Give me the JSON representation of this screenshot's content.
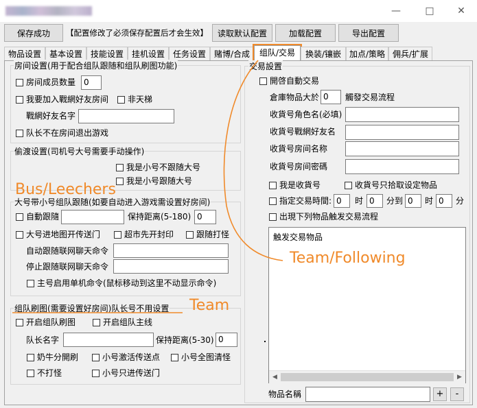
{
  "window": {
    "minimize": "—",
    "maximize": "□",
    "close": "✕"
  },
  "toolbar": {
    "save_label": "保存成功",
    "notice": "【配置修改了必须保存配置后才会生效】",
    "read_default_label": "读取默认配置",
    "load_label": "加载配置",
    "export_label": "导出配置"
  },
  "tabs": [
    {
      "label": "物品设置"
    },
    {
      "label": "基本设置"
    },
    {
      "label": "技能设置"
    },
    {
      "label": "挂机设置"
    },
    {
      "label": "任务设置"
    },
    {
      "label": "赌博/合成"
    },
    {
      "label": "组队/交易"
    },
    {
      "label": "换装/镶嵌"
    },
    {
      "label": "加点/策略"
    },
    {
      "label": "佣兵/扩展"
    }
  ],
  "room": {
    "title": "房间设置(用于配合组队跟随和组队刷图功能)",
    "member_count_label": "房间成员数量",
    "member_count_value": "0",
    "join_friend_label": "我要加入戰網好友房间",
    "non_ladder_label": "非天梯",
    "friend_name_label": "戰網好友名字",
    "friend_name_value": "",
    "leader_exit_label": "队长不在房间退出游戏"
  },
  "ferry": {
    "title": "偷渡设置(司机号大号需要手动操作)",
    "small_no_follow_label": "我是小号不跟随大号",
    "small_follow_label": "我是小号跟随大号"
  },
  "follow": {
    "title": "大号带小号组队跟随(如要自动进入游戏需设置好房间)",
    "auto_follow_label": "自動跟隨",
    "auto_follow_value": "",
    "keep_distance_label": "保持距离(5-180)",
    "keep_distance_value": "0",
    "map_tp_label": "大号进地图开传送门",
    "super_seal_label": "超市先开封印",
    "follow_fight_label": "跟随打怪",
    "auto_follow_cmd_label": "自动跟随联网聊天命令",
    "auto_follow_cmd_value": "",
    "stop_follow_cmd_label": "停止跟随联网聊天命令",
    "stop_follow_cmd_value": "",
    "single_cmd_label": "主号启用单机命令(鼠标移动到这里不动显示命令)"
  },
  "team_farm": {
    "title": "组队刷图(需要设置好房间)队长号不用设置",
    "enable_farm_label": "开启组队刷图",
    "enable_main_label": "开启组队主线",
    "leader_name_label": "队长名字",
    "leader_name_value": "",
    "keep_distance_label": "保持距离(5-30)",
    "keep_distance_value": "0",
    "cow_split_label": "奶牛分開刷",
    "small_tp_label": "小号激活传送点",
    "small_clear_label": "小号全图清怪",
    "no_fight_label": "不打怪",
    "small_tp_only_label": "小号只进传送门"
  },
  "trade": {
    "title": "交易設置",
    "enable_label": "開啓自動交易",
    "storage_prefix": "倉庫物品大於",
    "storage_value": "0",
    "storage_suffix": "觸發交易流程",
    "receiver_name_label": "收貨号角色名(必填)",
    "receiver_name_value": "",
    "receiver_friend_label": "收貨号戰網好友名",
    "receiver_friend_value": "",
    "receiver_room_label": "收貨号房间名称",
    "receiver_room_value": "",
    "receiver_pwd_label": "收貨号房间密碼",
    "receiver_pwd_value": "",
    "i_am_receiver_label": "我是收貨号",
    "receiver_pick_label": "收貨号只拾取设定物品",
    "time_label": "指定交易時間:",
    "time_h1": "0",
    "time_unit_h": "时",
    "time_m1": "0",
    "time_unit_to": "分到",
    "time_h2": "0",
    "time_m2": "0",
    "time_unit_m": "分",
    "trigger_items_label": "出現下列物品触发交易流程",
    "list_header": "触发交易物品",
    "item_name_label": "物品名稱",
    "item_name_value": "",
    "add_label": "+",
    "remove_label": "-"
  },
  "annotations": {
    "bus": "Bus/Leechers",
    "team_following": "Team/Following",
    "team": "Team",
    "color": "#f08a2a"
  }
}
